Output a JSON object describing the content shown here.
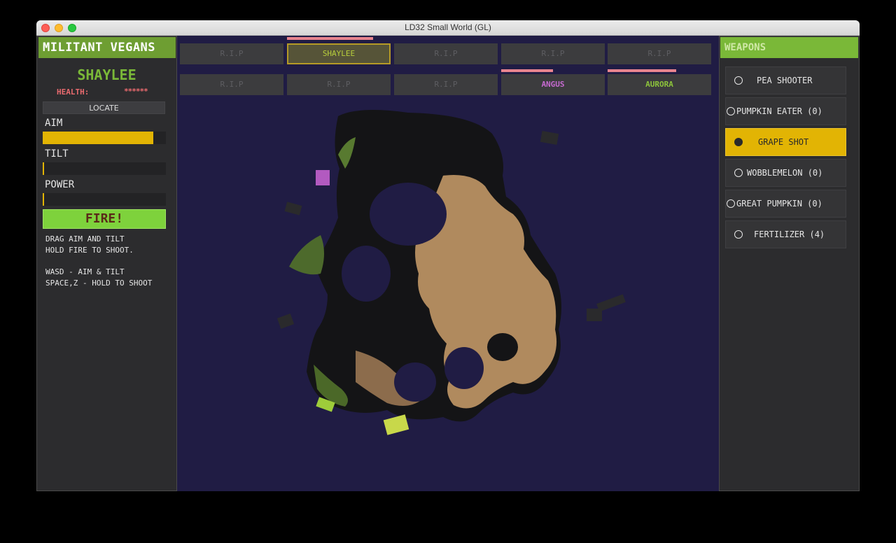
{
  "window": {
    "title": "LD32 Small World (GL)"
  },
  "left_panel": {
    "team_name": "MILITANT VEGANS",
    "player_name": "SHAYLEE",
    "health_label": "HEALTH:",
    "health_value": "******",
    "locate_label": "LOCATE",
    "aim": {
      "label": "AIM",
      "level": 0.9
    },
    "tilt": {
      "label": "TILT",
      "level": 0.0
    },
    "power": {
      "label": "POWER",
      "level": 0.0
    },
    "fire_label": "FIRE!",
    "help_line1": "DRAG AIM AND TILT",
    "help_line2": "HOLD FIRE TO SHOOT.",
    "help_line3": "WASD - AIM & TILT",
    "help_line4": "SPACE,Z - HOLD TO SHOOT"
  },
  "players_row1": [
    {
      "label": "R.I.P",
      "state": "dead"
    },
    {
      "label": "SHAYLEE",
      "state": "active",
      "health": 0.83
    },
    {
      "label": "R.I.P",
      "state": "dead"
    },
    {
      "label": "R.I.P",
      "state": "dead"
    },
    {
      "label": "R.I.P",
      "state": "dead"
    }
  ],
  "players_row2": [
    {
      "label": "R.I.P",
      "state": "dead"
    },
    {
      "label": "R.I.P",
      "state": "dead"
    },
    {
      "label": "R.I.P",
      "state": "dead"
    },
    {
      "label": "ANGUS",
      "state": "alive",
      "health": 0.5,
      "color": "#c66ad0"
    },
    {
      "label": "AURORA",
      "state": "alive",
      "health": 0.66,
      "color": "#8dc43b"
    }
  ],
  "weapons": {
    "header": "WEAPONS",
    "items": [
      {
        "label": "PEA SHOOTER",
        "selected": false
      },
      {
        "label": "PUMPKIN EATER (0)",
        "selected": false
      },
      {
        "label": "GRAPE SHOT",
        "selected": true
      },
      {
        "label": "WOBBLEMELON (0)",
        "selected": false
      },
      {
        "label": "GREAT PUMPKIN (0)",
        "selected": false
      },
      {
        "label": "FERTILIZER (4)",
        "selected": false
      }
    ]
  },
  "colors": {
    "team_green": "#6e9e32",
    "accent_yellow": "#e2b404",
    "fire_green": "#7ed23c",
    "health_pink": "#e8848f",
    "world_bg": "#201c44"
  }
}
